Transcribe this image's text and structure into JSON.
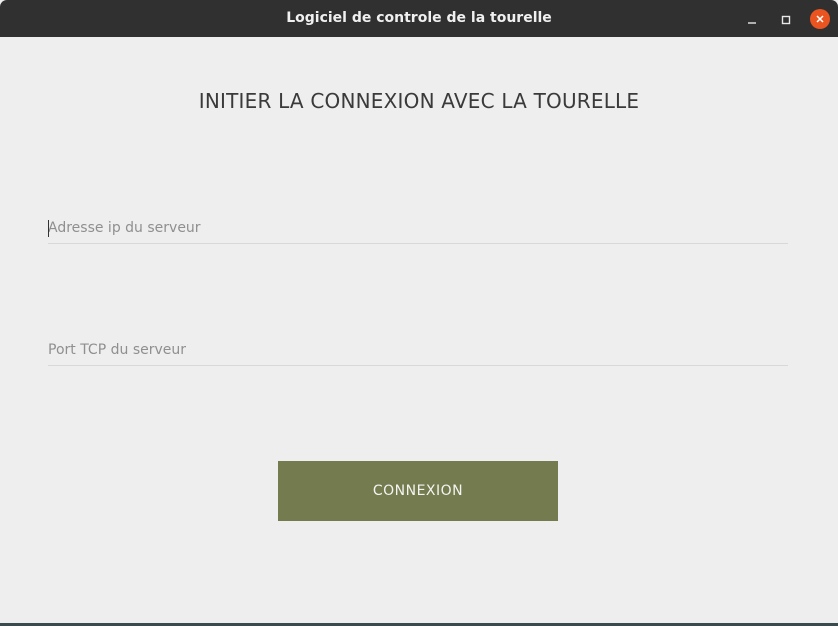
{
  "window": {
    "title": "Logiciel de controle de la tourelle",
    "controls": {
      "minimize": "minimize-icon",
      "maximize": "maximize-icon",
      "close": "close-icon"
    },
    "close_color": "#e95420"
  },
  "main": {
    "heading": "INITIER LA CONNEXION AVEC LA TOURELLE",
    "ip_field": {
      "placeholder": "Adresse ip du serveur",
      "value": ""
    },
    "port_field": {
      "placeholder": "Port TCP du serveur",
      "value": ""
    },
    "connect_label": "CONNEXION",
    "accent_color": "#747b4f"
  }
}
